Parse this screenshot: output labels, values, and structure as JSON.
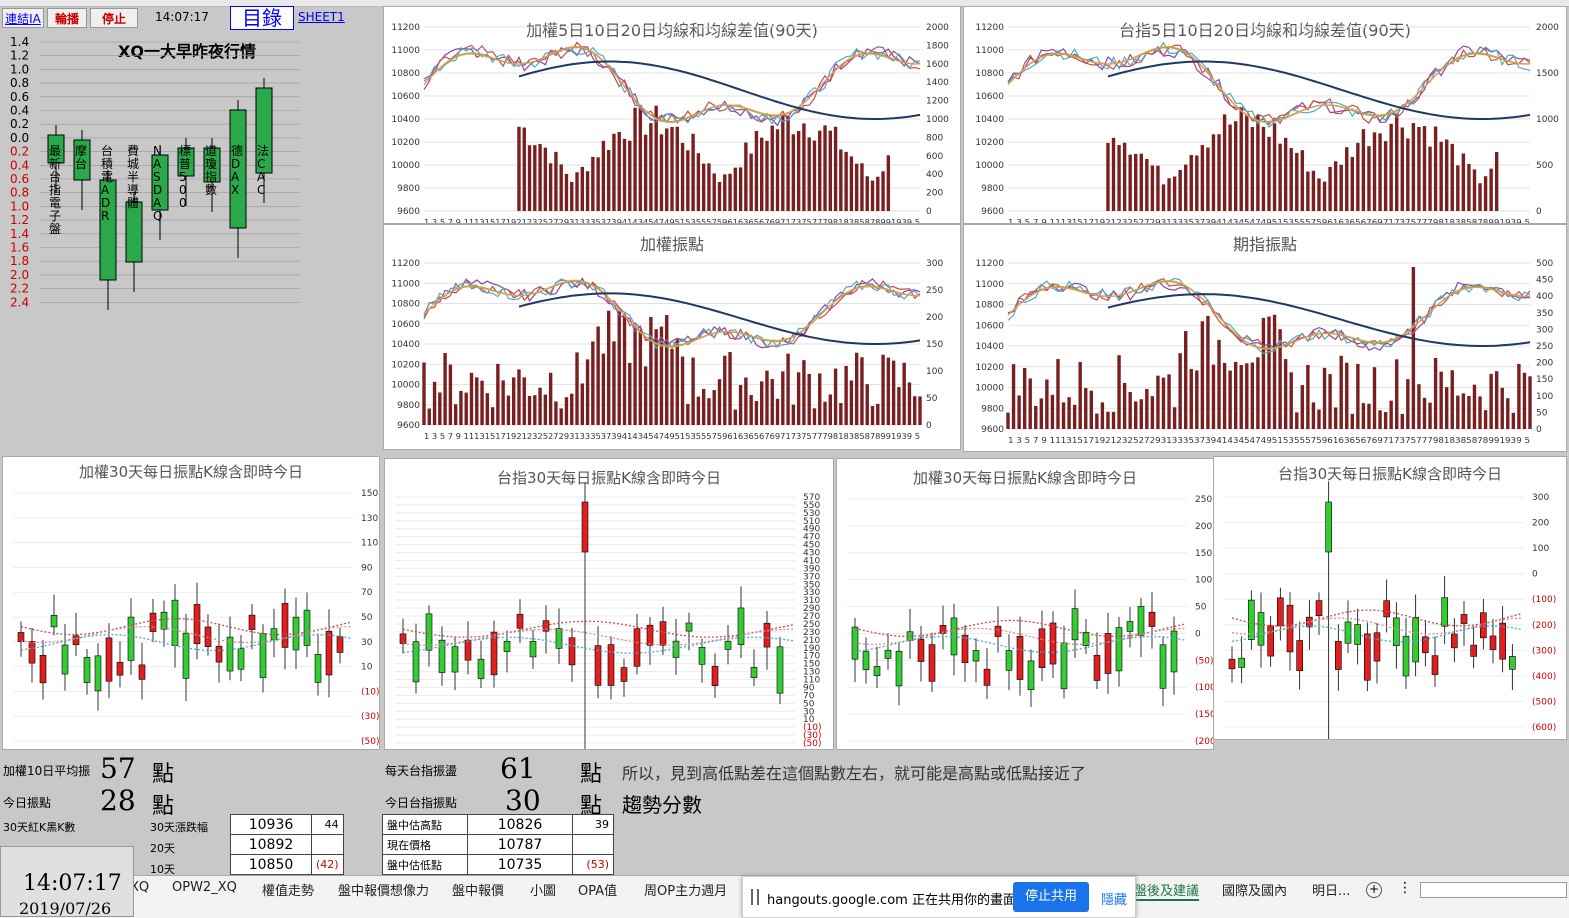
{
  "toolbar": {
    "link1": "連結IA",
    "rotate": "輪播",
    "stop": "停止",
    "time": "14:07:17",
    "catalog": "目錄",
    "sheet": "SHEET1"
  },
  "overnight": {
    "title": "XQ一大早昨夜行情",
    "yticks": [
      "1.4",
      "1.2",
      "1.0",
      "0.8",
      "0.6",
      "0.4",
      "0.2",
      "0.0",
      "0.2",
      "0.4",
      "0.6",
      "0.8",
      "1.0",
      "1.2",
      "1.4",
      "1.6",
      "1.8",
      "2.0",
      "2.2",
      "2.4"
    ],
    "labels": [
      "最新台指電子盤",
      "摩台",
      "台積電ADR",
      "費城半導體",
      "NASDAQ",
      "標普500",
      "道瓊指數",
      "德DAX",
      "法CAC"
    ]
  },
  "titles": {
    "ma_taiex": "加權5日10日20日均線和均線差值(90天)",
    "ma_futures": "台指5日10日20日均線和均線差值(90天)",
    "amp_taiex": "加權振點",
    "amp_futures": "期指振點",
    "k_taiex_a": "加權30天每日振點K線含即時今日",
    "k_fut_a": "台指30天每日振點K線含即時今日",
    "k_taiex_b": "加權30天每日振點K線含即時今日",
    "k_fut_b": "台指30天每日振點K線含即時今日"
  },
  "axes": {
    "price_left": [
      "11200",
      "11000",
      "10800",
      "10600",
      "10400",
      "10200",
      "10000",
      "9800",
      "9600"
    ],
    "ma1_right": [
      "2000",
      "1800",
      "1600",
      "1400",
      "1200",
      "1000",
      "800",
      "600",
      "400",
      "200",
      "0"
    ],
    "ma2_right": [
      "2000",
      "1500",
      "1000",
      "500",
      "0"
    ],
    "amp1_right": [
      "300",
      "250",
      "200",
      "150",
      "100",
      "50",
      "0"
    ],
    "amp2_right": [
      "500",
      "450",
      "400",
      "350",
      "300",
      "250",
      "200",
      "150",
      "100",
      "50",
      "0"
    ],
    "xaxis": "1 3 5 7 9 1113151719212325272931333537394143454749515355575961636567697173757779818385878991939 5",
    "k1_right": [
      "150",
      "130",
      "110",
      "90",
      "70",
      "50",
      "30",
      "10",
      "(10)",
      "(30)",
      "(50)"
    ],
    "k2_right": [
      "570",
      "550",
      "530",
      "510",
      "490",
      "470",
      "450",
      "430",
      "410",
      "390",
      "370",
      "350",
      "330",
      "310",
      "290",
      "270",
      "250",
      "230",
      "210",
      "190",
      "170",
      "150",
      "130",
      "110",
      "90",
      "70",
      "50",
      "30",
      "10",
      "(10)",
      "(30)",
      "(50)"
    ],
    "k3_right": [
      "250",
      "200",
      "150",
      "100",
      "50",
      "0",
      "(50)",
      "(100)",
      "(150)",
      "(200)"
    ],
    "k4_right": [
      "300",
      "200",
      "100",
      "0",
      "(100)",
      "(200)",
      "(300)",
      "(400)",
      "(500)",
      "(600)"
    ]
  },
  "stats": {
    "avg10_label": "加權10日平均振",
    "avg10_value": "57",
    "unit": "點",
    "today_label": "今日振點",
    "today_value": "28",
    "daily_fut_label": "每天台指振盪",
    "daily_fut_value": "61",
    "note": "所以，見到高低點差在這個點數左右，就可能是高點或低點接近了",
    "today_fut_label": "今日台指振點",
    "today_fut_value": "30",
    "trend": "趨勢分數",
    "redblack": "30天紅K黑K數",
    "updown": "30天漲跌幅",
    "rows": [
      {
        "k": "",
        "v": "10936",
        "d": "44"
      },
      {
        "k": "20天",
        "v": "10892",
        "d": ""
      },
      {
        "k": "10天",
        "v": "10850",
        "d": "(42)"
      }
    ],
    "intraday": [
      {
        "k": "盤中估高點",
        "v": "10826",
        "d": "39"
      },
      {
        "k": "現在價格",
        "v": "10787",
        "d": ""
      },
      {
        "k": "盤中估低點",
        "v": "10735",
        "d": "(53)"
      }
    ]
  },
  "clock": {
    "time": "14:07:17",
    "date": "2019/07/26"
  },
  "tabs": [
    "XQ",
    "OPW2_XQ",
    "權值走勢",
    "盤中報價想像力",
    "盤中報價",
    "小圖",
    "OPA值",
    "周OP主力週月",
    "盤後及建議",
    "國際及國內",
    "明日..."
  ],
  "share": {
    "text": "hangouts.google.com 正在共用你的畫面。",
    "stop": "停止共用",
    "hide": "隱藏"
  }
}
